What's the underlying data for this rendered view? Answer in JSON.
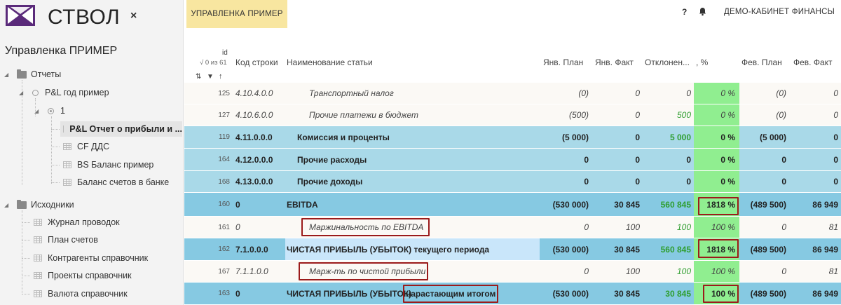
{
  "app": {
    "brand": "СТВОЛ",
    "close_label": "×"
  },
  "sidebar": {
    "report_name": "Управленка ПРИМЕР",
    "tree": [
      {
        "label": "Отчеты"
      },
      {
        "label": "P&L год пример"
      },
      {
        "label": "1"
      },
      {
        "label": "P&L Отчет о прибыли и ..."
      },
      {
        "label": "CF ДДС"
      },
      {
        "label": "BS Баланс пример"
      },
      {
        "label": "Баланс счетов в банке"
      },
      {
        "label": "Исходники"
      },
      {
        "label": "Журнал проводок"
      },
      {
        "label": "План счетов"
      },
      {
        "label": "Контрагенты справочник"
      },
      {
        "label": "Проекты справочник"
      },
      {
        "label": "Валюта справочник"
      }
    ]
  },
  "topbar": {
    "tab_label": "УПРАВЛЕНКА ПРИМЕР",
    "help": "?",
    "account": "ДЕМО-КАБИНЕТ ФИНАНСЫ"
  },
  "table": {
    "headers": {
      "id": "id",
      "count": "√ 0 из 61",
      "code": "Код строки",
      "name": "Наименование статьи",
      "jan_plan": "Янв. План",
      "jan_fact": "Янв. Факт",
      "deviation": "Отклонен...",
      "pct": ", %",
      "feb_plan": "Фев. План",
      "feb_fact": "Фев. Факт"
    },
    "rows": [
      {
        "id": "125",
        "code": "4.10.4.0.0",
        "name": "Транспортный налог",
        "jan_plan": "(0)",
        "jan_fact": "0",
        "dev": "0",
        "pct": "0 %",
        "feb_plan": "(0)",
        "feb_fact": "0"
      },
      {
        "id": "127",
        "code": "4.10.6.0.0",
        "name": "Прочие платежи в бюджет",
        "jan_plan": "(500)",
        "jan_fact": "0",
        "dev": "500",
        "pct": "0 %",
        "feb_plan": "(0)",
        "feb_fact": "0"
      },
      {
        "id": "119",
        "code": "4.11.0.0.0",
        "name": "Комиссия и проценты",
        "jan_plan": "(5 000)",
        "jan_fact": "0",
        "dev": "5 000",
        "pct": "0 %",
        "feb_plan": "(5 000)",
        "feb_fact": "0"
      },
      {
        "id": "164",
        "code": "4.12.0.0.0",
        "name": "Прочие расходы",
        "jan_plan": "0",
        "jan_fact": "0",
        "dev": "0",
        "pct": "0 %",
        "feb_plan": "0",
        "feb_fact": "0"
      },
      {
        "id": "168",
        "code": "4.13.0.0.0",
        "name": "Прочие доходы",
        "jan_plan": "0",
        "jan_fact": "0",
        "dev": "0",
        "pct": "0 %",
        "feb_plan": "0",
        "feb_fact": "0"
      },
      {
        "id": "160",
        "code": "0",
        "name": "EBITDA",
        "jan_plan": "(530 000)",
        "jan_fact": "30 845",
        "dev": "560 845",
        "pct": "1818 %",
        "feb_plan": "(489 500)",
        "feb_fact": "86 949"
      },
      {
        "id": "161",
        "code": "0",
        "name": "Маржинальность по EBITDA",
        "jan_plan": "0",
        "jan_fact": "100",
        "dev": "100",
        "pct": "100 %",
        "feb_plan": "0",
        "feb_fact": "81"
      },
      {
        "id": "162",
        "code": "7.1.0.0.0",
        "name": "ЧИСТАЯ ПРИБЫЛЬ (УБЫТОК) текущего периода",
        "jan_plan": "(530 000)",
        "jan_fact": "30 845",
        "dev": "560 845",
        "pct": "1818 %",
        "feb_plan": "(489 500)",
        "feb_fact": "86 949"
      },
      {
        "id": "167",
        "code": "7.1.1.0.0",
        "name": "Марж-ть по чистой прибыли",
        "jan_plan": "0",
        "jan_fact": "100",
        "dev": "100",
        "pct": "100 %",
        "feb_plan": "0",
        "feb_fact": "81"
      },
      {
        "id": "163",
        "code": "0",
        "name_a": "ЧИСТАЯ ПРИБЫЛЬ (УБЫТОК)",
        "name_b": "нарастающим итогом",
        "jan_plan": "(530 000)",
        "jan_fact": "30 845",
        "dev": "30 845",
        "pct": "100 %",
        "feb_plan": "(489 500)",
        "feb_fact": "86 949"
      }
    ]
  },
  "colors": {
    "blue_row": "#a9d9e8",
    "dark_blue_row": "#86c9e2",
    "light_blue_row": "#c9e6fa",
    "pct_green": "#90ee90",
    "tab_yellow": "#f8e6a0",
    "highlight_red": "#9b1b1b",
    "deviation_green": "#2f9e2f"
  }
}
